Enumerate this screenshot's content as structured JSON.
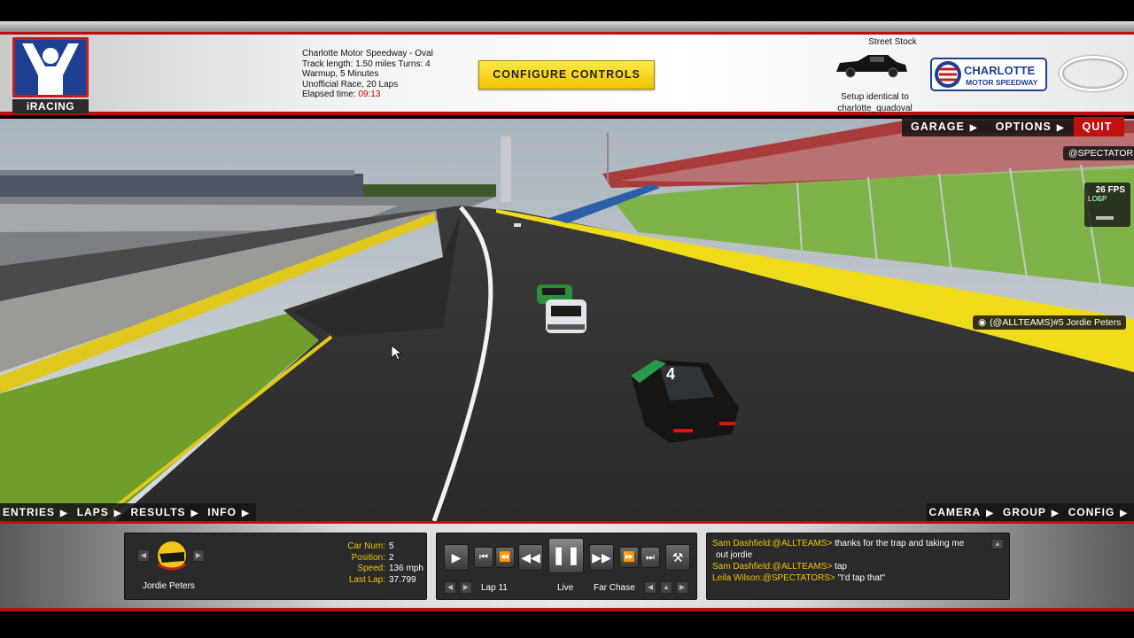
{
  "header": {
    "logo_text": "iRACING",
    "track_name": "Charlotte Motor Speedway - Oval",
    "track_length": "Track length: 1.50 miles Turns: 4",
    "session": "Warmup, 5 Minutes",
    "race_type": "Unofficial Race, 20 Laps",
    "elapsed_label": "Elapsed time:",
    "elapsed_value": "09:13",
    "configure_button": "CONFIGURE CONTROLS",
    "car_class": "Street Stock",
    "setup_line1": "Setup identical to",
    "setup_line2": "charlotte_quadoval",
    "track_logo_line1": "CHARLOTTE",
    "track_logo_line2": "MOTOR SPEEDWAY"
  },
  "top_menu": {
    "garage": "GARAGE",
    "options": "OPTIONS",
    "quit": "QUIT"
  },
  "overlay": {
    "spectators_tag": "@SPECTATORS",
    "fps": "26 FPS",
    "fps_labels": "LOSP",
    "car_tag": "(@ALLTEAMS)#5 Jordie Peters",
    "car_number": "4"
  },
  "bottom_menu_left": [
    "ENTRIES",
    "LAPS",
    "RESULTS",
    "INFO"
  ],
  "bottom_menu_right": [
    "CAMERA",
    "GROUP",
    "CONFIG"
  ],
  "driver_panel": {
    "name": "Jordie Peters",
    "labels": [
      "Car Num:",
      "Position:",
      "Speed:",
      "Last Lap:"
    ],
    "values": [
      "5",
      "2",
      "136 mph",
      "37.799"
    ]
  },
  "replay_panel": {
    "lap": "Lap 11",
    "mode": "Live",
    "camera": "Far Chase"
  },
  "chat": [
    {
      "name": "Sam Dashfield:@ALLTEAMS>",
      "text": "thanks for the trap and taking me"
    },
    {
      "name": "",
      "text": "out jordie"
    },
    {
      "name": "Sam Dashfield:@ALLTEAMS>",
      "text": "tap"
    },
    {
      "name": "Leila Wilson:@SPECTATORS>",
      "text": "\"I'd tap that\""
    }
  ],
  "colors": {
    "accent_red": "#c01010",
    "button_yellow": "#f0c400",
    "label_yellow": "#f0c400"
  }
}
